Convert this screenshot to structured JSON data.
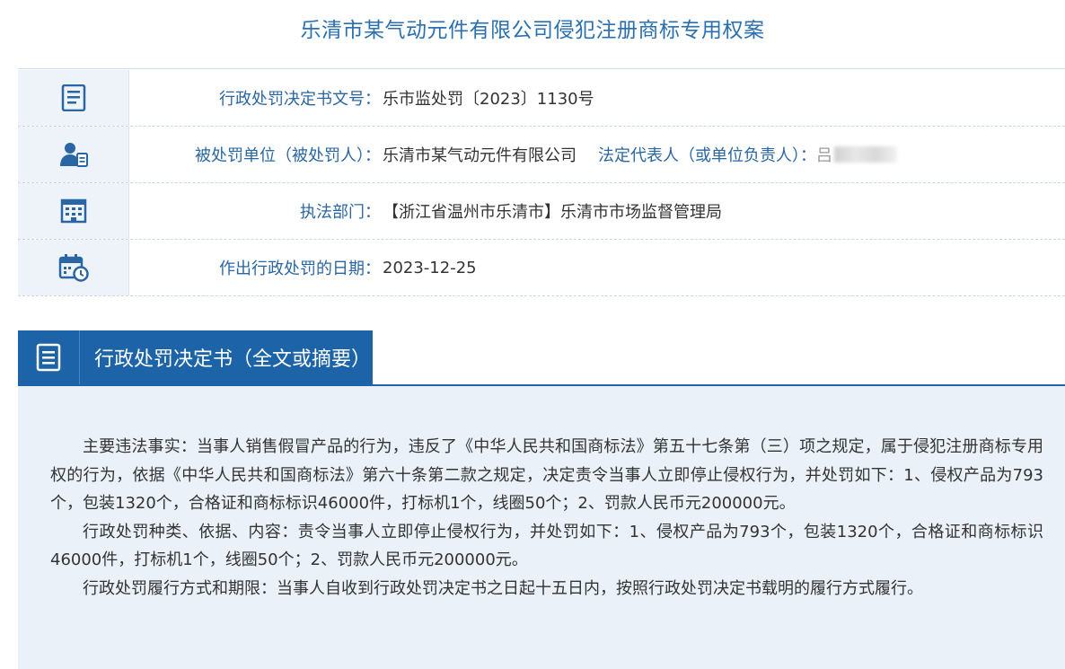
{
  "page": {
    "title": "乐清市某气动元件有限公司侵犯注册商标专用权案"
  },
  "info_rows": {
    "doc_no": {
      "icon": "document-list-icon",
      "label": "行政处罚决定书文号：",
      "value": "乐市监处罚〔2023〕1130号"
    },
    "party": {
      "icon": "user-id-icon",
      "label": "被处罚单位（被处罚人）：",
      "value": "乐清市某气动元件有限公司",
      "rep_label": "法定代表人（或单位负责人）：",
      "rep_value": "吕"
    },
    "dept": {
      "icon": "building-icon",
      "label": "执法部门：",
      "value": "【浙江省温州市乐清市】乐清市市场监督管理局"
    },
    "date": {
      "icon": "calendar-clock-icon",
      "label": "作出行政处罚的日期：",
      "value": "2023-12-25"
    }
  },
  "section": {
    "icon": "document-icon",
    "title": "行政处罚决定书（全文或摘要）"
  },
  "paragraphs": {
    "p1": "主要违法事实：当事人销售假冒产品的行为，违反了《中华人民共和国商标法》第五十七条第（三）项之规定，属于侵犯注册商标专用权的行为，依据《中华人民共和国商标法》第六十条第二款之规定，决定责令当事人立即停止侵权行为，并处罚如下：1、侵权产品为793个，包装1320个，合格证和商标标识46000件，打标机1个，线圈50个；2、罚款人民币元200000元。",
    "p2": "行政处罚种类、依据、内容：责令当事人立即停止侵权行为，并处罚如下：1、侵权产品为793个，包装1320个，合格证和商标标识46000件，打标机1个，线圈50个；2、罚款人民币元200000元。",
    "p3": "行政处罚履行方式和期限：当事人自收到行政处罚决定书之日起十五日内，按照行政处罚决定书载明的履行方式履行。"
  },
  "colors": {
    "accent": "#1d63a8",
    "title": "#2a6fb0",
    "label": "#2a66a3",
    "panel_bg": "#eaf1f8"
  }
}
